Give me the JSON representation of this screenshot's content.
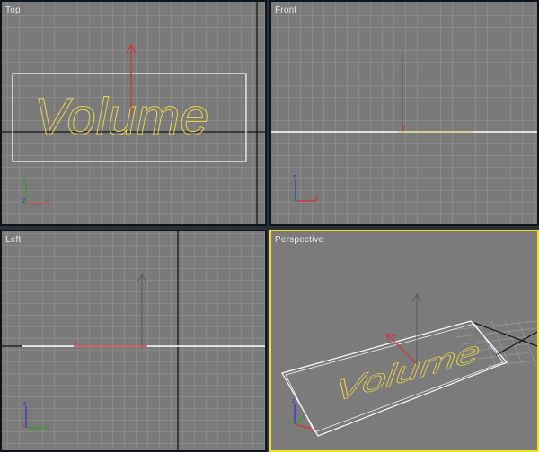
{
  "viewports": {
    "top": {
      "label": "Top"
    },
    "front": {
      "label": "Front"
    },
    "left": {
      "label": "Left"
    },
    "perspective": {
      "label": "Perspective"
    }
  },
  "scene": {
    "text_object": "Volume"
  },
  "axes": {
    "x": "x",
    "y": "y",
    "z": "z"
  },
  "colors": {
    "active_border": "#f0e02a",
    "text_spline": "#e8d24a",
    "selection": "#ffffff",
    "gizmo_x": "#d83030",
    "gizmo_y": "#2aa02a",
    "gizmo_z": "#3030d8"
  },
  "active_viewport": "perspective"
}
